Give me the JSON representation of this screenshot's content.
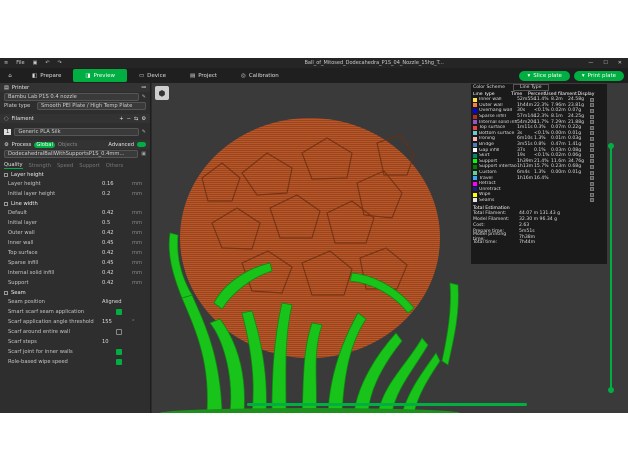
{
  "titlebar": {
    "title": "Ball_of_Mitosed_Dodecahedra_P1S_04_Nozzle_15hg_T...",
    "menu_label": "File",
    "min": "—",
    "max": "☐",
    "close": "✕"
  },
  "tabs": [
    {
      "label": "Prepare"
    },
    {
      "label": "Preview"
    },
    {
      "label": "Device"
    },
    {
      "label": "Project"
    },
    {
      "label": "Calibration"
    }
  ],
  "actions": {
    "slice": "Slice plate",
    "print": "Print plate"
  },
  "printer": {
    "header": "Printer",
    "name": "Bambu Lab P1S 0.4 nozzle",
    "plate_label": "Plate type",
    "plate_value": "Smooth PEI Plate / High Temp Plate"
  },
  "filament": {
    "header": "Filament",
    "index": "1",
    "name": "Generic PLA Silk"
  },
  "process": {
    "header": "Process",
    "global": "Global",
    "objects": "Objects",
    "advanced": "Advanced",
    "profile": "DodecahedralBallWithSupportsP1S_0.4mm..."
  },
  "quality_tabs": [
    "Quality",
    "Strength",
    "Speed",
    "Support",
    "Others"
  ],
  "groups": {
    "layer_height": "Layer height",
    "line_width": "Line width",
    "seam": "Seam"
  },
  "params_layer": [
    {
      "label": "Layer height",
      "value": "0.16",
      "unit": "mm"
    },
    {
      "label": "Initial layer height",
      "value": "0.2",
      "unit": "mm"
    }
  ],
  "params_line": [
    {
      "label": "Default",
      "value": "0.42",
      "unit": "mm"
    },
    {
      "label": "Initial layer",
      "value": "0.5",
      "unit": "mm"
    },
    {
      "label": "Outer wall",
      "value": "0.42",
      "unit": "mm"
    },
    {
      "label": "Inner wall",
      "value": "0.45",
      "unit": "mm"
    },
    {
      "label": "Top surface",
      "value": "0.42",
      "unit": "mm"
    },
    {
      "label": "Sparse infill",
      "value": "0.45",
      "unit": "mm"
    },
    {
      "label": "Internal solid infill",
      "value": "0.42",
      "unit": "mm"
    },
    {
      "label": "Support",
      "value": "0.42",
      "unit": "mm"
    }
  ],
  "params_seam": [
    {
      "label": "Seam position",
      "value": "Aligned"
    },
    {
      "label": "Smart scarf seam application",
      "checked": true
    },
    {
      "label": "Scarf application angle threshold",
      "value": "155",
      "unit": "°"
    },
    {
      "label": "Scarf around entire wall",
      "checked": false
    },
    {
      "label": "Scarf steps",
      "value": "10"
    },
    {
      "label": "Scarf joint for inner walls",
      "checked": true
    },
    {
      "label": "Role-based wipe speed",
      "checked": true
    }
  ],
  "legend": {
    "title": "Color Scheme",
    "scheme": "Line Type",
    "headers": [
      "Line Type",
      "Time",
      "Percent",
      "Used filament",
      "Display"
    ],
    "rows": [
      {
        "name": "Inner wall",
        "color": "#ffe64d",
        "time": "52m55s",
        "pct": "11.4%",
        "m": "8.2m",
        "g": "24.58g"
      },
      {
        "name": "Outer wall",
        "color": "#ff7d38",
        "time": "1h44m",
        "pct": "22.3%",
        "m": "7.96m",
        "g": "23.81g"
      },
      {
        "name": "Overhang wall",
        "color": "#0000ff",
        "time": "30s",
        "pct": "<0.1%",
        "m": "0.02m",
        "g": "0.07g"
      },
      {
        "name": "Sparse infill",
        "color": "#b03029",
        "time": "57m14s",
        "pct": "12.3%",
        "m": "8.1m",
        "g": "24.25g"
      },
      {
        "name": "Internal solid infill",
        "color": "#9654cc",
        "time": "54m20s",
        "pct": "11.7%",
        "m": "7.29m",
        "g": "21.88g"
      },
      {
        "name": "Top surface",
        "color": "#f04040",
        "time": "1m11s",
        "pct": "0.3%",
        "m": "0.07m",
        "g": "0.22g"
      },
      {
        "name": "Bottom surface",
        "color": "#66cccc",
        "time": "3s",
        "pct": "<0.1%",
        "m": "0.00m",
        "g": "0.01g"
      },
      {
        "name": "Ironing",
        "color": "#ffb3b3",
        "time": "6m10s",
        "pct": "1.3%",
        "m": "0.01m",
        "g": "0.03g"
      },
      {
        "name": "Bridge",
        "color": "#4d80ba",
        "time": "3m51s",
        "pct": "0.8%",
        "m": "0.47m",
        "g": "1.41g"
      },
      {
        "name": "Gap infill",
        "color": "#ffffff",
        "time": "37s",
        "pct": "0.1%",
        "m": "0.03m",
        "g": "0.08g"
      },
      {
        "name": "Skirt",
        "color": "#00876e",
        "time": "19s",
        "pct": "<0.1%",
        "m": "0.02m",
        "g": "0.06g"
      },
      {
        "name": "Support",
        "color": "#00ff00",
        "time": "1h39m",
        "pct": "21.4%",
        "m": "11.6m",
        "g": "34.76g"
      },
      {
        "name": "Support interface",
        "color": "#008000",
        "time": "1h13m",
        "pct": "15.7%",
        "m": "0.23m",
        "g": "0.68g"
      },
      {
        "name": "Custom",
        "color": "#5ed194",
        "time": "6m4s",
        "pct": "1.3%",
        "m": "0.00m",
        "g": "0.01g"
      },
      {
        "name": "Travel",
        "color": "#38a8ff",
        "time": "1h16m",
        "pct": "16.4%",
        "m": "",
        "g": ""
      },
      {
        "name": "Retract",
        "color": "#ff00ff",
        "time": "",
        "pct": "",
        "m": "",
        "g": ""
      },
      {
        "name": "Unretract",
        "color": "#1a1a8c",
        "time": "",
        "pct": "",
        "m": "",
        "g": ""
      },
      {
        "name": "Wipe",
        "color": "#ffff00",
        "time": "",
        "pct": "",
        "m": "",
        "g": ""
      },
      {
        "name": "Seams",
        "color": "#e6e6e6",
        "time": "",
        "pct": "",
        "m": "",
        "g": ""
      }
    ],
    "estimation_title": "Total Estimation",
    "estimation": [
      {
        "k": "Total Filament:",
        "v": "44.07 m   131.43 g"
      },
      {
        "k": "Model Filament:",
        "v": "32.30 m   96.34 g"
      },
      {
        "k": "Cost:",
        "v": "2.63"
      },
      {
        "k": "Prepare time:",
        "v": "5m51s"
      },
      {
        "k": "Model printing time:",
        "v": "7h38m"
      },
      {
        "k": "Total time:",
        "v": "7h44m"
      }
    ]
  }
}
